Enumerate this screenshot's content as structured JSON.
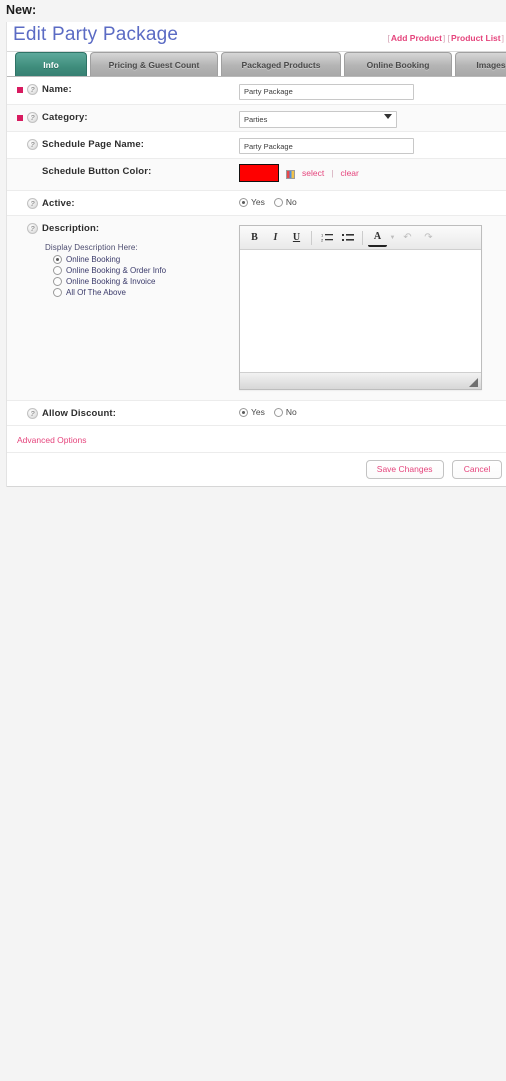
{
  "page": {
    "new_caption": "New:",
    "title": "Edit Party Package"
  },
  "header_links": {
    "open_bracket": "[",
    "close_bracket": "]",
    "add_product": "Add Product",
    "product_list": "Product List"
  },
  "tabs": [
    {
      "label": "Info",
      "active": true
    },
    {
      "label": "Pricing & Guest Count",
      "active": false
    },
    {
      "label": "Packaged Products",
      "active": false
    },
    {
      "label": "Online Booking",
      "active": false
    },
    {
      "label": "Images",
      "active": false
    }
  ],
  "fields": {
    "name": {
      "label": "Name:",
      "value": "Party Package",
      "placeholder": "",
      "required": true,
      "help_icon": "help-icon"
    },
    "category": {
      "label": "Category:",
      "value": "Parties",
      "options": [
        "Parties"
      ],
      "required": true,
      "help_icon": "help-icon"
    },
    "schedule_page_name": {
      "label": "Schedule Page Name:",
      "value": "Party Package",
      "placeholder": "",
      "required": false,
      "help_icon": "help-icon"
    },
    "schedule_button_color": {
      "label": "Schedule Button Color:",
      "color": "#fe0000",
      "palette_icon": "palette-icon",
      "select_label": "select",
      "separator": "|",
      "clear_label": "clear"
    },
    "active": {
      "label": "Active:",
      "yes_label": "Yes",
      "no_label": "No",
      "selected": "Yes",
      "help_icon": "help-icon"
    },
    "description": {
      "label": "Description:",
      "help_icon": "help-icon",
      "choices_title": "Display Description Here:",
      "choices": [
        {
          "label": "Online Booking",
          "selected": true
        },
        {
          "label": "Online Booking & Order Info",
          "selected": false
        },
        {
          "label": "Online Booking & Invoice",
          "selected": false
        },
        {
          "label": "All Of The Above",
          "selected": false
        }
      ],
      "editor_value": ""
    },
    "allow_discount": {
      "label": "Allow Discount:",
      "yes_label": "Yes",
      "no_label": "No",
      "selected": "Yes",
      "help_icon": "help-icon"
    }
  },
  "editor_toolbar": [
    {
      "name": "bold-icon",
      "glyph": "B"
    },
    {
      "name": "italic-icon",
      "glyph": "I"
    },
    {
      "name": "underline-icon",
      "glyph": "U"
    },
    {
      "name": "ordered-list-icon",
      "glyph": "≡"
    },
    {
      "name": "unordered-list-icon",
      "glyph": "≡"
    },
    {
      "name": "font-color-icon",
      "glyph": "A"
    },
    {
      "name": "undo-icon",
      "glyph": "↶"
    },
    {
      "name": "redo-icon",
      "glyph": "↷"
    }
  ],
  "advanced_options": {
    "label": "Advanced Options"
  },
  "actions": {
    "save_label": "Save Changes",
    "cancel_label": "Cancel"
  },
  "colors": {
    "accent_pink": "#e5447c",
    "tab_active": "#3f8d7c",
    "title_blue": "#5b6bc4",
    "required_marker": "#d81b60",
    "swatch": "#fe0000"
  }
}
